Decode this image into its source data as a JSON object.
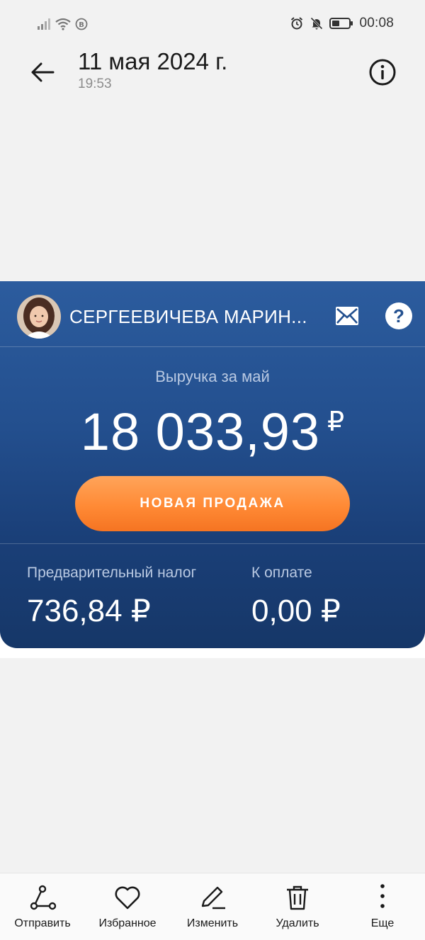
{
  "status_bar": {
    "time": "00:08"
  },
  "header": {
    "date": "11 мая 2024 г.",
    "time": "19:53"
  },
  "card": {
    "user_name": "СЕРГЕЕВИЧЕВА МАРИН...",
    "revenue_label": "Выручка за май",
    "revenue_amount": "18 033,93",
    "currency": "₽",
    "new_sale_label": "НОВАЯ ПРОДАЖА",
    "tax_label": "Предварительный налог",
    "tax_value": "736,84 ₽",
    "pay_label": "К оплате",
    "pay_value": "0,00 ₽"
  },
  "actions": [
    {
      "label": "Отправить",
      "icon": "share-icon"
    },
    {
      "label": "Избранное",
      "icon": "heart-icon"
    },
    {
      "label": "Изменить",
      "icon": "pencil-icon"
    },
    {
      "label": "Удалить",
      "icon": "trash-icon"
    },
    {
      "label": "Еще",
      "icon": "more-vertical-icon"
    }
  ],
  "colors": {
    "card_gradient_top": "#2c5c9e",
    "card_gradient_bottom": "#163768",
    "accent_orange": "#ff8a35",
    "background": "#f2f2f2"
  }
}
